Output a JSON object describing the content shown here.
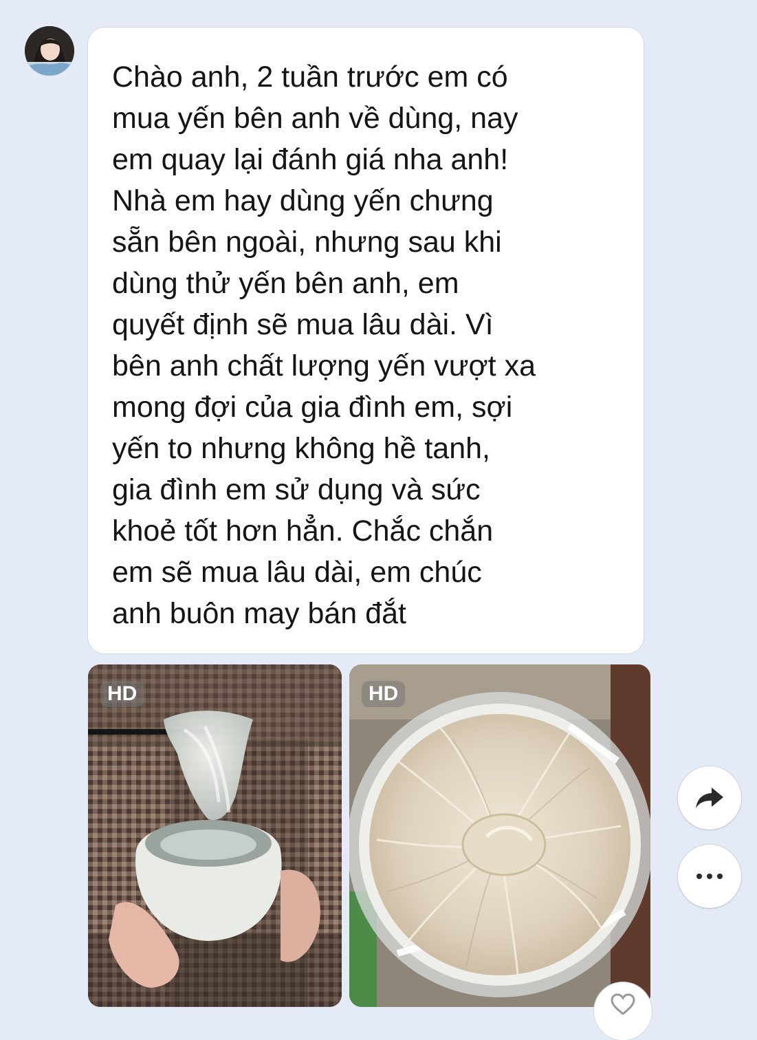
{
  "message": {
    "text": "Chào anh, 2 tuần trước em có\nmua yến bên anh về dùng, nay\nem quay lại đánh giá nha anh!\nNhà em hay dùng yến chưng\nsẵn bên ngoài, nhưng sau khi\ndùng thử yến bên anh, em\nquyết định sẽ mua lâu dài. Vì\nbên anh chất lượng yến vượt xa\nmong đợi của gia đình em, sợi\nyến to nhưng không hề tanh,\ngia đình em sử dụng và sức\nkhoẻ tốt hơn hẳn. Chắc chắn\nem sẽ mua lâu dài, em chúc\nanh buôn may bán đắt"
  },
  "attachments": [
    {
      "badge": "HD"
    },
    {
      "badge": "HD"
    }
  ],
  "icons": {
    "share": "share-arrow-icon",
    "more": "more-dots-icon",
    "like": "heart-icon"
  },
  "colors": {
    "background": "#e4ebf6",
    "bubble": "#ffffff",
    "text": "#151515"
  }
}
